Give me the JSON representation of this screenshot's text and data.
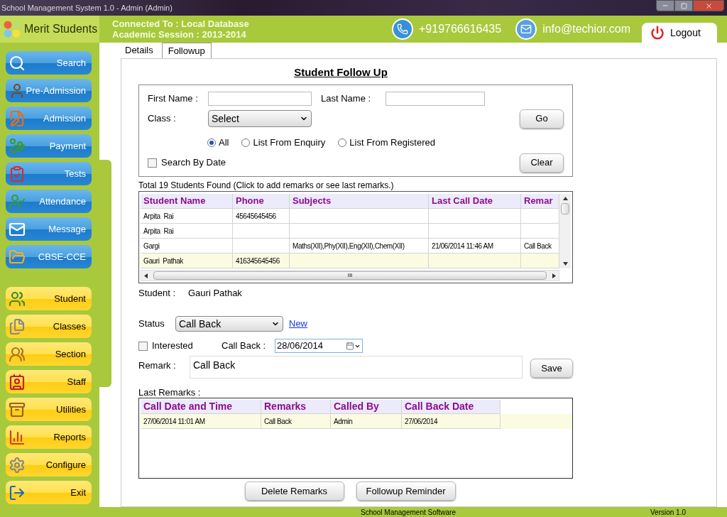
{
  "window": {
    "title": "School Management System 1.0  -  Admin (Admin)"
  },
  "header": {
    "logo": "Merit Students",
    "connection": "Connected To : Local Database",
    "session": "Academic Session : 2013-2014",
    "phone": "+919766616435",
    "email": "info@techior.com",
    "logout": "Logout"
  },
  "sidebar": {
    "items": [
      {
        "label": "Search",
        "kind": "module"
      },
      {
        "label": "Pre-Admission",
        "kind": "module"
      },
      {
        "label": "Admission",
        "kind": "module"
      },
      {
        "label": "Payment",
        "kind": "module"
      },
      {
        "label": "Tests",
        "kind": "module"
      },
      {
        "label": "Attendance",
        "kind": "module"
      },
      {
        "label": "Message",
        "kind": "module"
      },
      {
        "label": "CBSE-CCE",
        "kind": "module"
      },
      {
        "label": "Student",
        "kind": "master"
      },
      {
        "label": "Classes",
        "kind": "master"
      },
      {
        "label": "Section",
        "kind": "master"
      },
      {
        "label": "Staff",
        "kind": "master"
      },
      {
        "label": "Utilities",
        "kind": "master"
      },
      {
        "label": "Reports",
        "kind": "master"
      },
      {
        "label": "Configure",
        "kind": "master"
      },
      {
        "label": "Exit",
        "kind": "master"
      }
    ]
  },
  "tabs": [
    {
      "label": "Details",
      "selected": false
    },
    {
      "label": "Followup",
      "selected": true
    }
  ],
  "form": {
    "title": "Student Follow Up",
    "first_name_label": "First Name :",
    "last_name_label": "Last Name :",
    "class_label": "Class :",
    "class_value": "Select",
    "go": "Go",
    "clear": "Clear",
    "filters": [
      {
        "label": "All",
        "selected": true
      },
      {
        "label": "List From Enquiry",
        "selected": false
      },
      {
        "label": "List From Registered",
        "selected": false
      }
    ],
    "search_by_date": {
      "label": "Search By Date",
      "checked": false
    }
  },
  "results": {
    "summary": "Total 19 Students Found (Click to add remarks or see last remarks.)",
    "columns": [
      "Student Name",
      "Phone",
      "Subjects",
      "Last Call Date",
      "Remar"
    ],
    "rows": [
      {
        "cells": [
          "Arpita  Rai",
          "45645645456",
          "",
          "",
          ""
        ],
        "selected": false
      },
      {
        "cells": [
          "Arpita  Rai",
          "",
          "",
          "",
          ""
        ],
        "selected": false
      },
      {
        "cells": [
          "Gargi",
          "",
          "Maths(XII),Phy(XII),Eng(XII),Chem(XII)",
          "21/06/2014 11:46 AM",
          "Call Back"
        ],
        "selected": false
      },
      {
        "cells": [
          "Gauri  Pathak",
          "416345645456",
          "",
          "",
          ""
        ],
        "selected": true
      }
    ],
    "scroll_grip": "III"
  },
  "student": {
    "label": "Student :",
    "value": "Gauri  Pathak"
  },
  "status": {
    "label": "Status",
    "value": "Call Back",
    "new_link": "New"
  },
  "interested": {
    "label": "Interested",
    "checked": false
  },
  "call_back": {
    "label": "Call Back :",
    "value": "28/06/2014"
  },
  "remark": {
    "label": "Remark :",
    "value": "Call Back",
    "save": "Save"
  },
  "last_remarks": {
    "label": "Last Remarks :",
    "columns": [
      "Call Date and Time",
      "Remarks",
      "Called By",
      "Call Back Date"
    ],
    "rows": [
      {
        "cells": [
          "27/06/2014 11:01 AM",
          "Call Back",
          "Admin",
          "27/06/2014"
        ],
        "selected": true
      }
    ]
  },
  "buttons": [
    "Delete Remarks",
    "Followup Reminder"
  ],
  "status_bar": {
    "product": "School Management Software",
    "version": "Version 1.0"
  }
}
